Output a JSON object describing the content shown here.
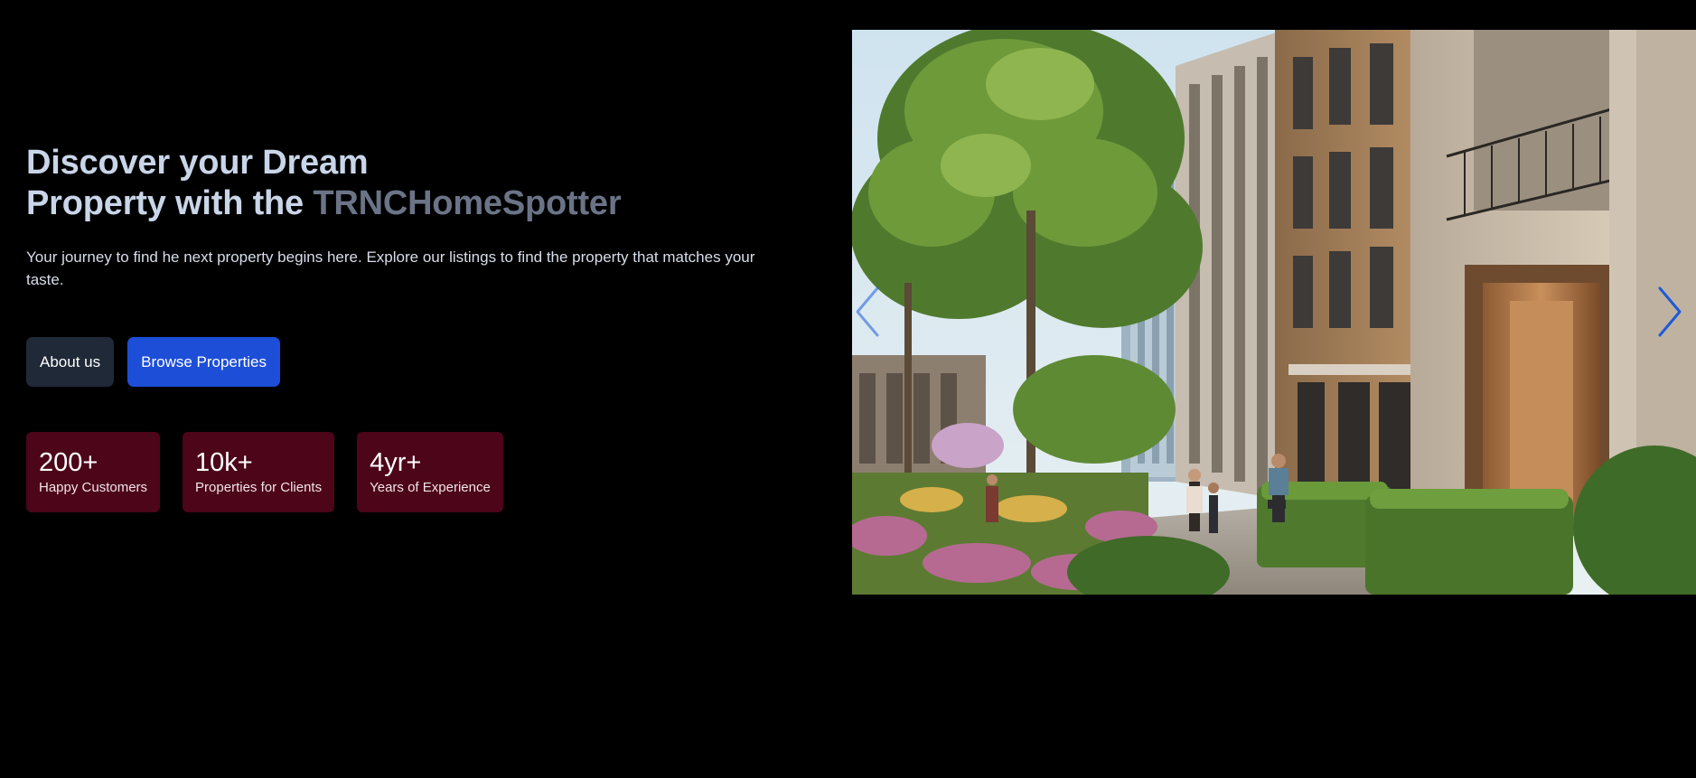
{
  "hero": {
    "headline_line1": "Discover your Dream",
    "headline_line2_prefix": "Property with the ",
    "headline_brand": "TRNCHomeSpotter",
    "subtitle": "Your journey to find he next property begins here. Explore our listings to find the property that matches your taste."
  },
  "buttons": {
    "about": "About us",
    "browse": "Browse Properties"
  },
  "stats": [
    {
      "value": "200+",
      "label": "Happy Customers"
    },
    {
      "value": "10k+",
      "label": "Properties for Clients"
    },
    {
      "value": "4yr+",
      "label": "Years of Experience"
    }
  ],
  "carousel": {
    "prev_icon": "chevron-left-icon",
    "next_icon": "chevron-right-icon"
  },
  "colors": {
    "background": "#000000",
    "headline": "#c9d5e8",
    "brand_accent": "#6b7487",
    "about_button": "#1f2937",
    "browse_button": "#1d4ed8",
    "stat_card": "#4c0519",
    "carousel_arrow": "#1e5ad8"
  }
}
